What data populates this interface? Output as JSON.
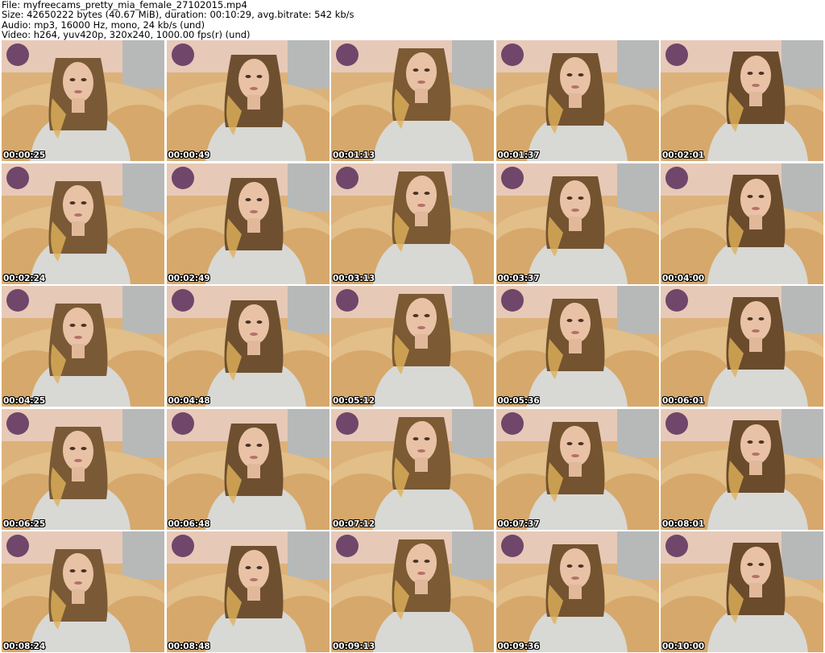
{
  "header": {
    "file_line": "File: myfreecams_pretty_mia_female_27102015.mp4",
    "size_line": "Size: 42650222 bytes (40.67 MiB), duration: 00:10:29, avg.bitrate: 542 kb/s",
    "audio_line": "Audio: mp3, 16000 Hz, mono, 24 kb/s (und)",
    "video_line": "Video: h264, yuv420p, 320x240, 1000.00 fps(r) (und)"
  },
  "thumbnails": [
    {
      "timestamp": "00:00:25"
    },
    {
      "timestamp": "00:00:49"
    },
    {
      "timestamp": "00:01:13"
    },
    {
      "timestamp": "00:01:37"
    },
    {
      "timestamp": "00:02:01"
    },
    {
      "timestamp": "00:02:24"
    },
    {
      "timestamp": "00:02:49"
    },
    {
      "timestamp": "00:03:13"
    },
    {
      "timestamp": "00:03:37"
    },
    {
      "timestamp": "00:04:00"
    },
    {
      "timestamp": "00:04:25"
    },
    {
      "timestamp": "00:04:48"
    },
    {
      "timestamp": "00:05:12"
    },
    {
      "timestamp": "00:05:36"
    },
    {
      "timestamp": "00:06:01"
    },
    {
      "timestamp": "00:06:25"
    },
    {
      "timestamp": "00:06:48"
    },
    {
      "timestamp": "00:07:12"
    },
    {
      "timestamp": "00:07:37"
    },
    {
      "timestamp": "00:08:01"
    },
    {
      "timestamp": "00:08:24"
    },
    {
      "timestamp": "00:08:48"
    },
    {
      "timestamp": "00:09:13"
    },
    {
      "timestamp": "00:09:36"
    },
    {
      "timestamp": "00:10:00"
    }
  ]
}
